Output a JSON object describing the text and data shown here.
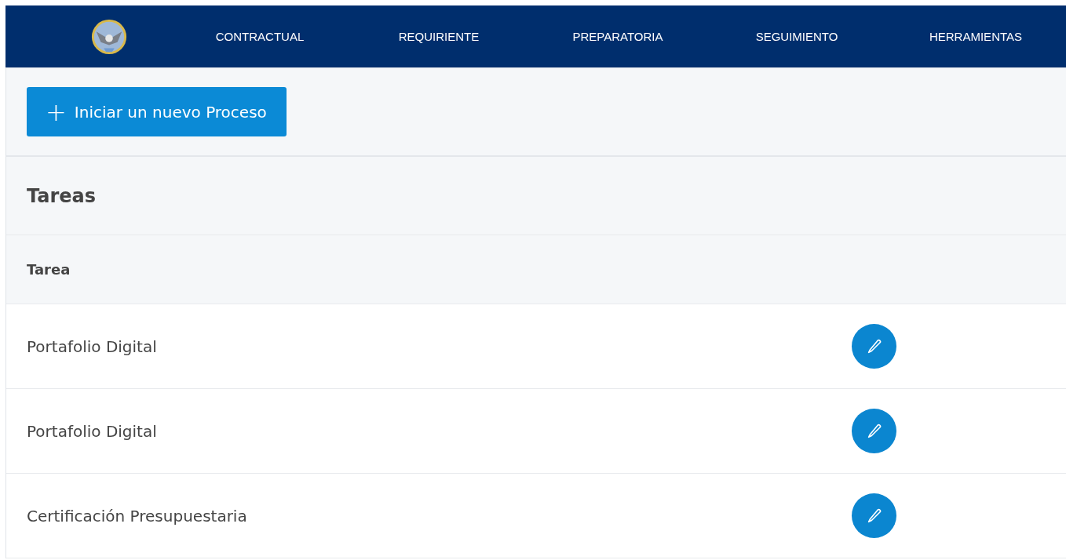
{
  "nav": {
    "items": [
      "CONTRACTUAL",
      "REQUIRIENTE",
      "PREPARATORIA",
      "SEGUIMIENTO",
      "HERRAMIENTAS"
    ]
  },
  "new_process_button": {
    "icon": "+",
    "label": "Iniciar un nuevo Proceso"
  },
  "tasks": {
    "title": "Tareas",
    "column": "Tarea",
    "rows": [
      {
        "name": "Portafolio Digital"
      },
      {
        "name": "Portafolio Digital"
      },
      {
        "name": "Certificación Presupuestaria"
      }
    ]
  }
}
